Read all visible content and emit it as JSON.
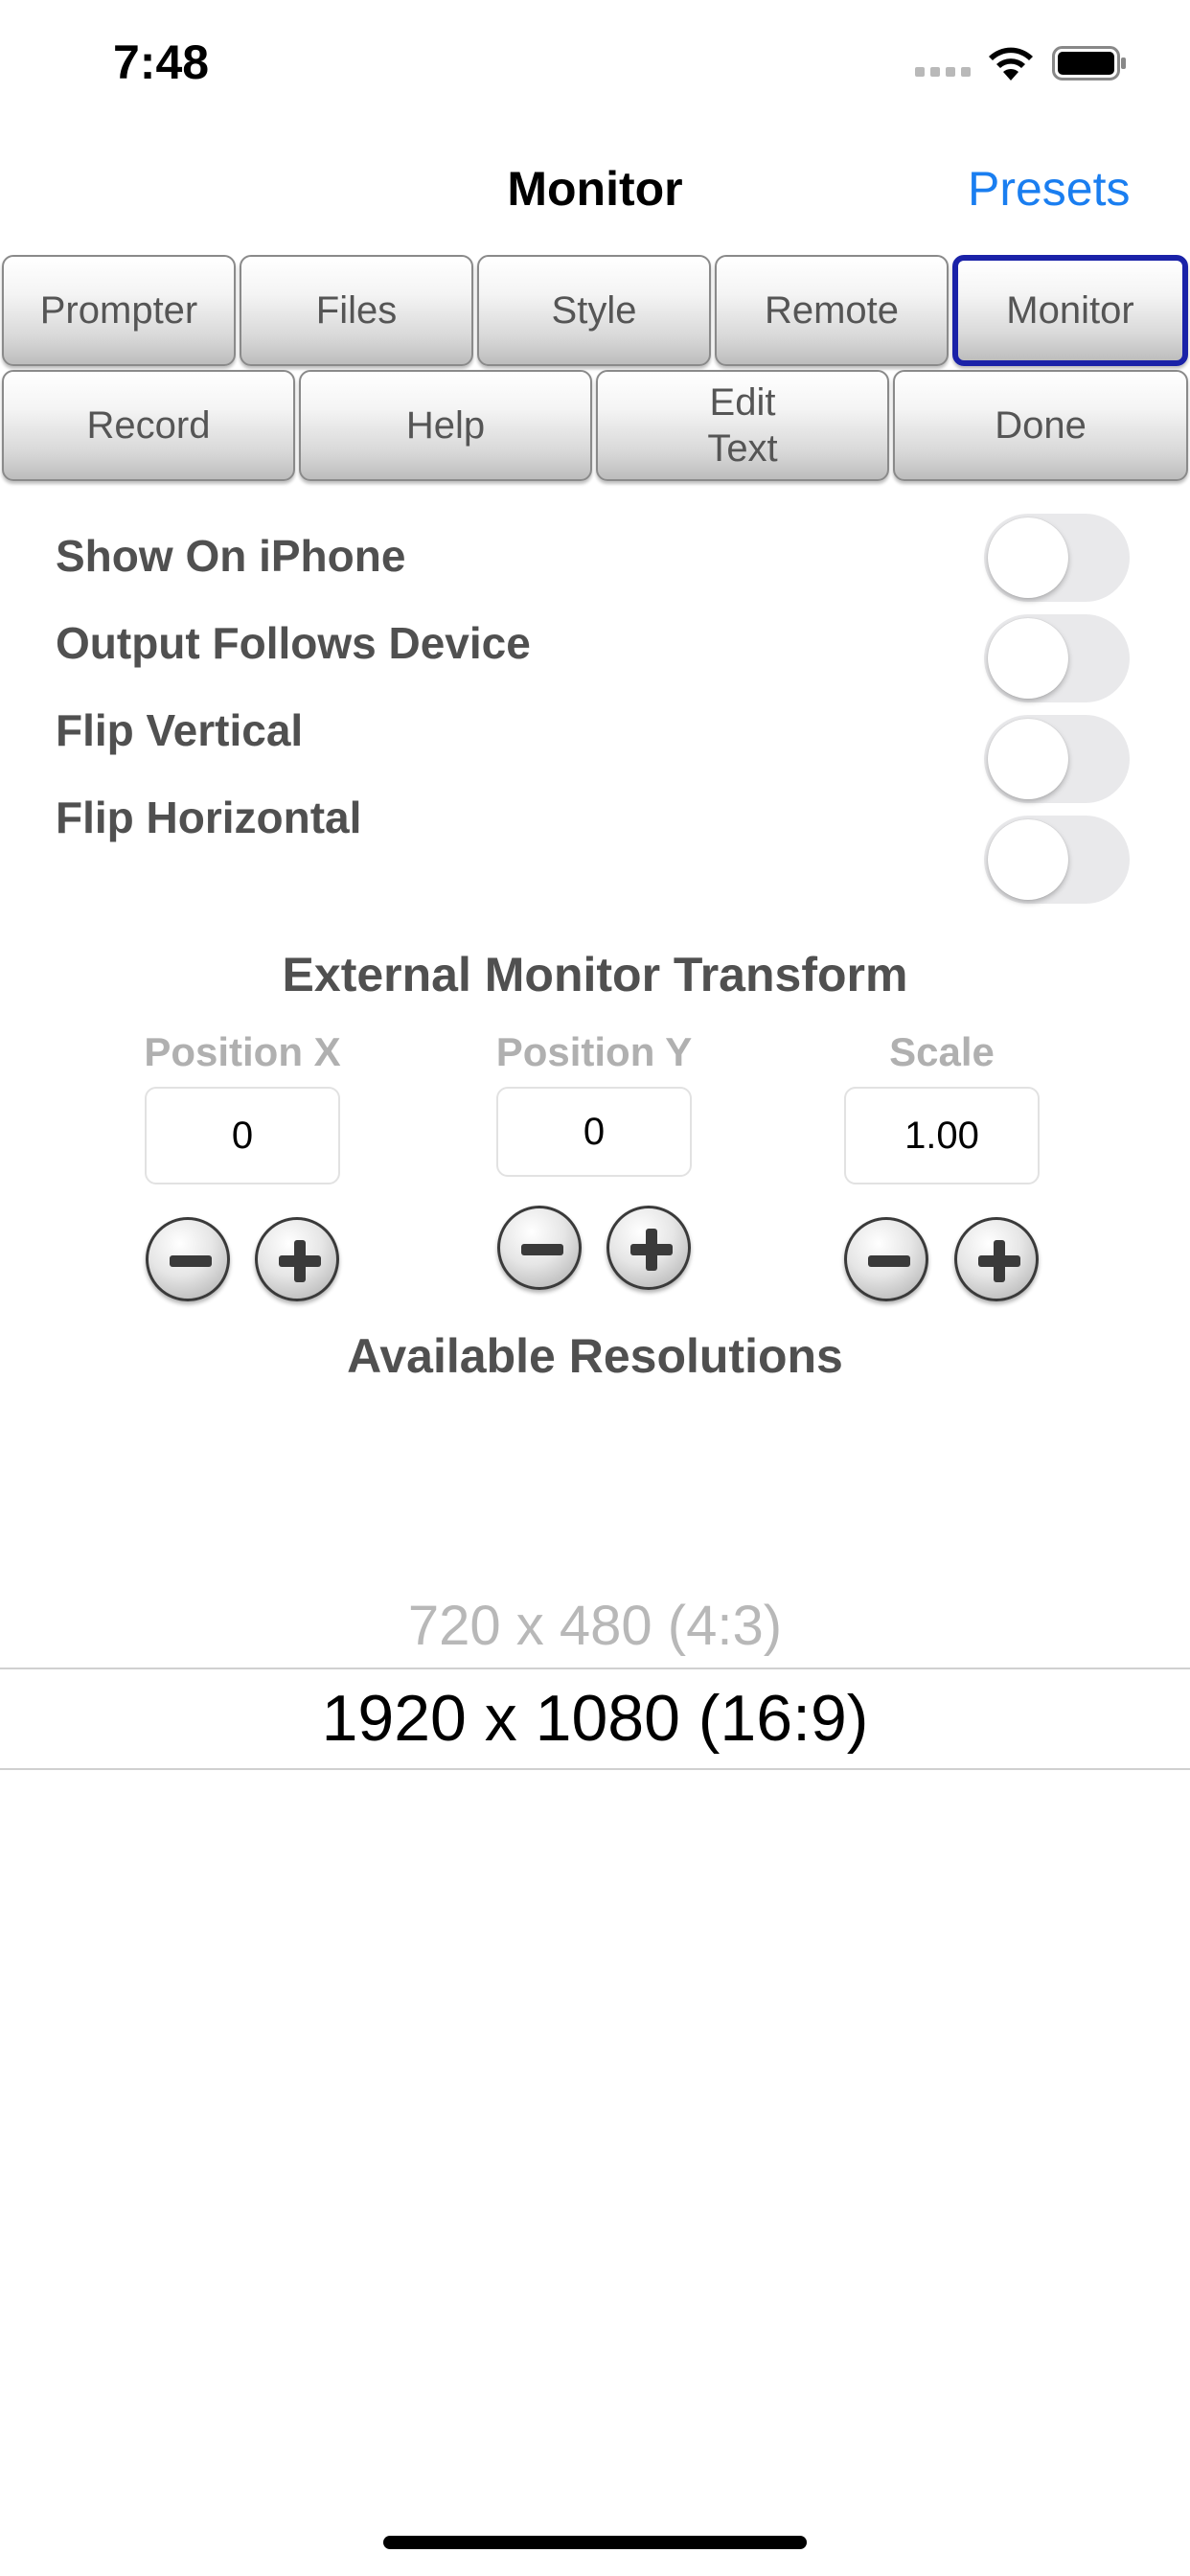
{
  "status_bar": {
    "time": "7:48"
  },
  "nav": {
    "title": "Monitor",
    "presets_label": "Presets"
  },
  "tabs_row1": [
    {
      "label": "Prompter"
    },
    {
      "label": "Files"
    },
    {
      "label": "Style"
    },
    {
      "label": "Remote"
    },
    {
      "label": "Monitor",
      "active": true
    }
  ],
  "tabs_row2": [
    {
      "label": "Record"
    },
    {
      "label": "Help"
    },
    {
      "label": "Edit\nText"
    },
    {
      "label": "Done"
    }
  ],
  "toggles": [
    {
      "label": "Show On iPhone",
      "on": false
    },
    {
      "label": "Output Follows Device",
      "on": false
    },
    {
      "label": "Flip Vertical",
      "on": false
    },
    {
      "label": "Flip Horizontal",
      "on": false
    }
  ],
  "transform": {
    "title": "External Monitor Transform",
    "position_x": {
      "label": "Position X",
      "value": "0"
    },
    "position_y": {
      "label": "Position Y",
      "value": "0"
    },
    "scale": {
      "label": "Scale",
      "value": "1.00"
    }
  },
  "resolutions": {
    "title": "Available Resolutions",
    "options": [
      "720 x 480 (4:3)",
      "1920 x 1080 (16:9)"
    ],
    "selected": "1920 x 1080 (16:9)"
  },
  "colors": {
    "accent": "#1a7ef0",
    "active_tab_border": "#1a22a8",
    "switch_off": "#e9e9eb"
  }
}
